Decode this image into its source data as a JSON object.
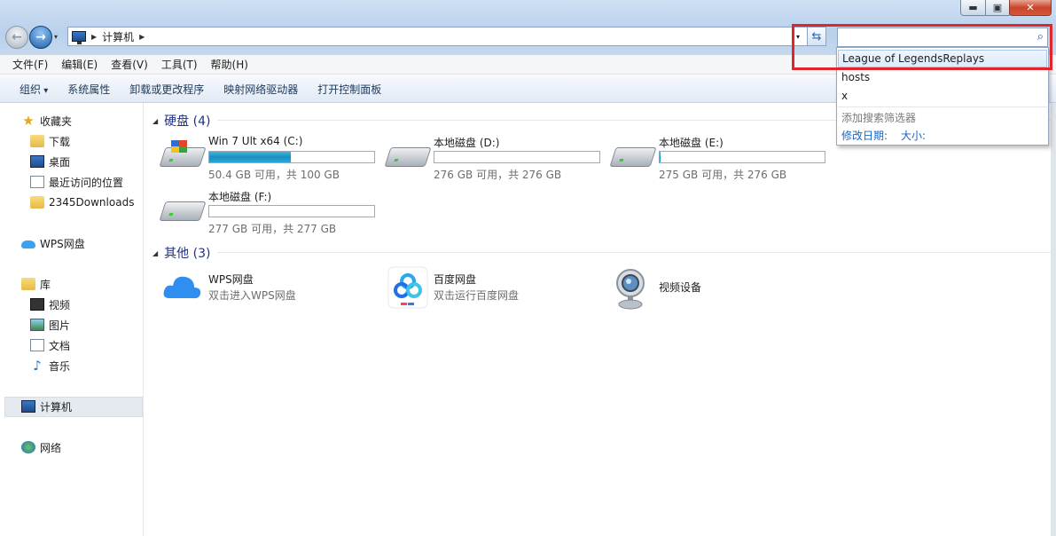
{
  "window": {
    "minimize_icon": "minimize-icon",
    "maximize_icon": "maximize-icon",
    "close_icon": "close-icon",
    "minimize_glyph": "▬",
    "maximize_glyph": "▣",
    "close_glyph": "✕"
  },
  "nav": {
    "back_glyph": "←",
    "forward_glyph": "→",
    "dropdown_glyph": "▾"
  },
  "address": {
    "path": "计算机",
    "separator": "▶",
    "dropdown_glyph": "▾",
    "refresh_glyph": "⇆"
  },
  "search": {
    "value": "",
    "placeholder": "",
    "icon_glyph": "⌕",
    "suggestions": [
      "League of LegendsReplays",
      "hosts",
      "x"
    ],
    "filter_title": "添加搜索筛选器",
    "filter_date": "修改日期:",
    "filter_size": "大小:"
  },
  "menu": [
    "文件(F)",
    "编辑(E)",
    "查看(V)",
    "工具(T)",
    "帮助(H)"
  ],
  "toolbar": [
    "组织",
    "系统属性",
    "卸载或更改程序",
    "映射网络驱动器",
    "打开控制面板"
  ],
  "sidebar": {
    "favorites": "收藏夹",
    "favorites_items": [
      "下载",
      "桌面",
      "最近访问的位置",
      "2345Downloads"
    ],
    "wps": "WPS网盘",
    "libraries": "库",
    "library_items": [
      "视频",
      "图片",
      "文档",
      "音乐"
    ],
    "computer": "计算机",
    "network": "网络"
  },
  "main": {
    "drives_header": "硬盘 (4)",
    "drives": [
      {
        "name": "Win 7 Ult x64 (C:)",
        "info": "50.4 GB 可用，共 100 GB",
        "used_fraction": 0.496
      },
      {
        "name": "本地磁盘 (D:)",
        "info": "276 GB 可用，共 276 GB",
        "used_fraction": 0.0
      },
      {
        "name": "本地磁盘 (E:)",
        "info": "275 GB 可用，共 276 GB",
        "used_fraction": 0.004
      },
      {
        "name": "本地磁盘 (F:)",
        "info": "277 GB 可用，共 277 GB",
        "used_fraction": 0.0
      }
    ],
    "other_header": "其他 (3)",
    "others": [
      {
        "name": "WPS网盘",
        "sub": "双击进入WPS网盘"
      },
      {
        "name": "百度网盘",
        "sub": "双击运行百度网盘"
      },
      {
        "name": "视频设备",
        "sub": ""
      }
    ]
  },
  "colors": {
    "highlight": "#e0262a",
    "link": "#1a64c8",
    "group_header": "#1e3287",
    "drive_bar": "#1b8fc0"
  }
}
